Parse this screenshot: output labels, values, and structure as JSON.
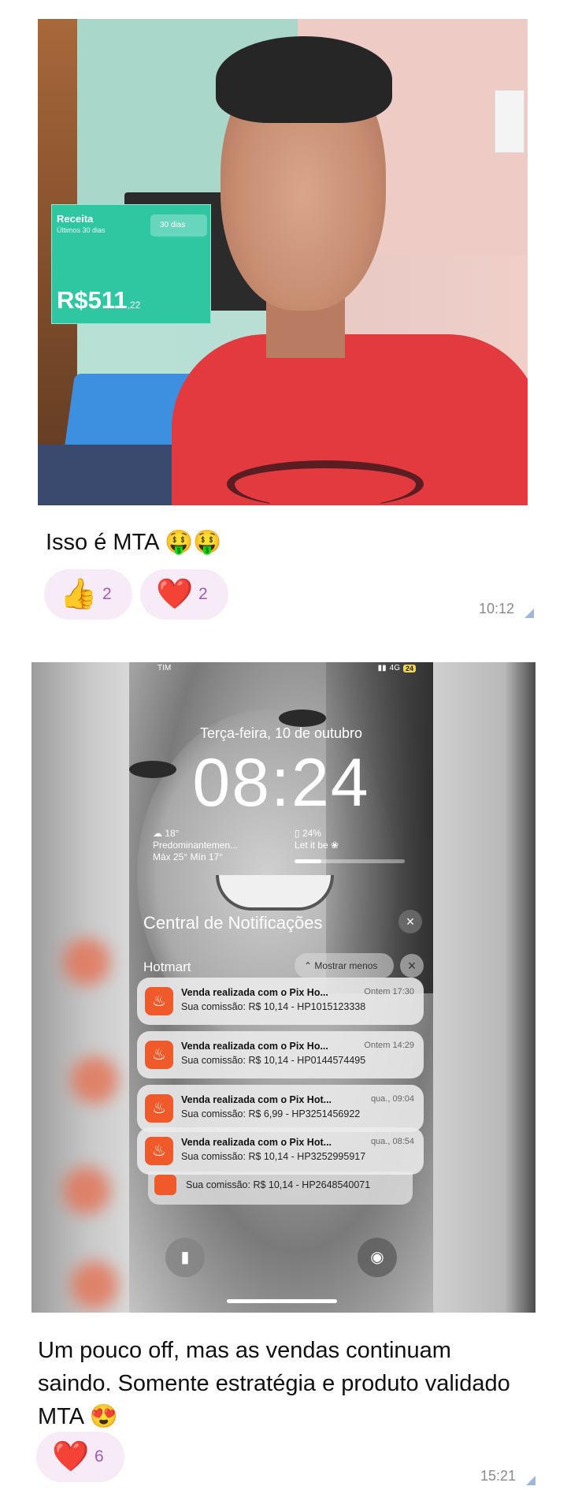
{
  "message1": {
    "revenue_card": {
      "title": "Receita",
      "subtitle": "Últimos 30 dias",
      "period_button": "30 dias",
      "amount": "R$511",
      "cents": ",22",
      "color": "#2fc6a2"
    },
    "caption": "Isso é MTA 🤑🤑",
    "reactions": [
      {
        "icon": "👍",
        "count": "2"
      },
      {
        "icon": "❤️",
        "count": "2"
      }
    ],
    "time": "10:12"
  },
  "message2": {
    "lockscreen": {
      "carrier": "TIM",
      "network": "4G",
      "battery": "24",
      "date": "Terça-feira, 10 de outubro",
      "time": "08:24",
      "weather_temp": "☁ 18°",
      "weather_desc": "Predominantemen...",
      "weather_range": "Máx 25° Mín 17°",
      "battery_widget": "▯ 24%",
      "battery_widget_sub": "Let it be ❀",
      "battery_level": 0.24,
      "notification_center": "Central de Notificações",
      "group_app": "Hotmart",
      "show_less": "Mostrar menos",
      "notifications": [
        {
          "title": "Venda realizada com o Pix Ho...",
          "time": "Ontem 17:30",
          "body": "Sua comissão: R$ 10,14 - HP1015123338"
        },
        {
          "title": "Venda realizada com o Pix Ho...",
          "time": "Ontem 14:29",
          "body": "Sua comissão: R$ 10,14 - HP0144574495"
        },
        {
          "title": "Venda realizada com o Pix Hot...",
          "time": "qua., 09:04",
          "body": "Sua comissão: R$ 6,99 - HP3251456922"
        },
        {
          "title": "Venda realizada com o Pix Hot...",
          "time": "qua., 08:54",
          "body": "Sua comissão: R$ 10,14 - HP3252995917"
        }
      ],
      "notification_behind": "Sua comissão: R$ 10,14 - HP2648540071",
      "accent": "#f05a2b"
    },
    "caption": "Um pouco off, mas as vendas continuam saindo. Somente estratégia e produto validado MTA 😍",
    "reactions": [
      {
        "icon": "❤️",
        "count": "6"
      }
    ],
    "time": "15:21"
  }
}
